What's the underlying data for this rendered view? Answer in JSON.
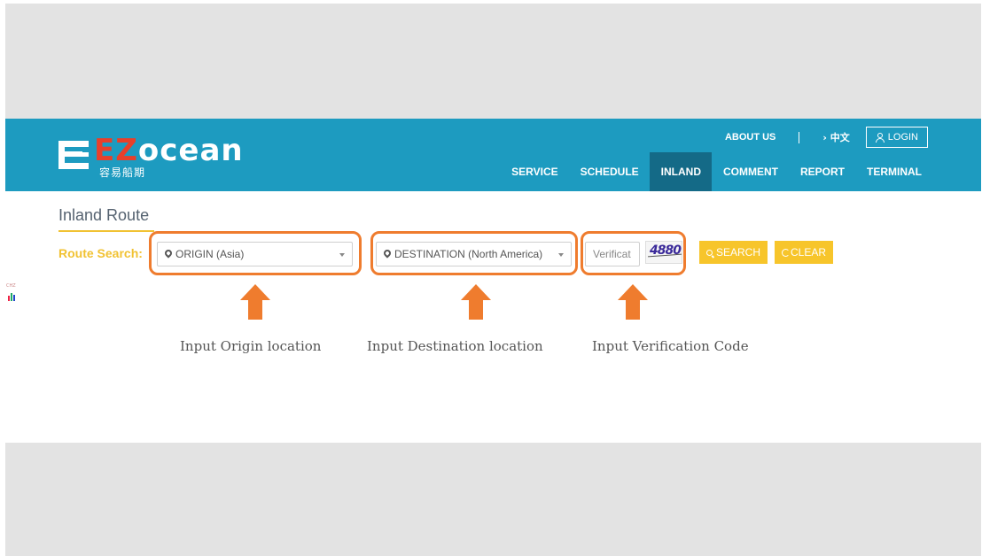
{
  "header": {
    "logo_text_prefix": "EZ",
    "logo_text_suffix": "ocean",
    "logo_subtitle": "容易船期",
    "top_links": {
      "about": "ABOUT US",
      "language": "› 中文",
      "login": "LOGIN"
    },
    "nav": [
      "SERVICE",
      "SCHEDULE",
      "INLAND",
      "COMMENT",
      "REPORT",
      "TERMINAL"
    ],
    "active_nav": "INLAND"
  },
  "main": {
    "title": "Inland Route",
    "route_search_label": "Route Search:",
    "origin_placeholder": "ORIGIN (Asia)",
    "destination_placeholder": "DESTINATION (North America)",
    "verification_placeholder": "Verificat",
    "captcha_code": "4880",
    "search_button": "SEARCH",
    "clear_button": "CLEAR"
  },
  "annotations": {
    "origin_caption": "Input Origin location",
    "destination_caption": "Input Destination location",
    "verification_caption": "Input Verification Code",
    "highlight_color": "#ef7c2e"
  },
  "colors": {
    "header_bg": "#1d9bc0",
    "active_nav_bg": "#146a87",
    "accent_yellow": "#f7c52b",
    "logo_red": "#e8402a"
  },
  "side_widget": {
    "label": "CHZ"
  }
}
